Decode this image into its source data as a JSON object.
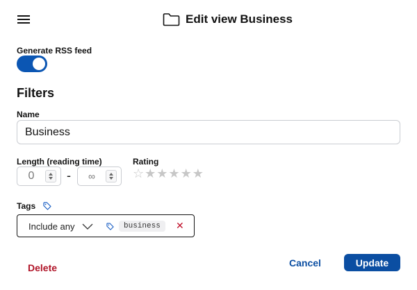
{
  "header": {
    "title": "Edit view Business",
    "menu_icon": "hamburger-menu-icon",
    "title_icon": "folder-icon"
  },
  "rss": {
    "label": "Generate RSS feed",
    "enabled": true
  },
  "filters": {
    "section_title": "Filters",
    "name": {
      "label": "Name",
      "value": "Business"
    },
    "length": {
      "label": "Length (reading time)",
      "min": "0",
      "separator": "-",
      "max": "∞"
    },
    "rating": {
      "label": "Rating",
      "filled": 0,
      "max": 6
    },
    "tags": {
      "label": "Tags",
      "mode": "Include any",
      "items": [
        "business"
      ],
      "remove_glyph": "✕"
    }
  },
  "actions": {
    "delete_label": "Delete",
    "cancel_label": "Cancel",
    "update_label": "Update"
  },
  "colors": {
    "accent": "#0b4ea2",
    "toggle_on": "#0b56b3",
    "danger": "#b01428",
    "star_empty": "#c7c7c7"
  }
}
